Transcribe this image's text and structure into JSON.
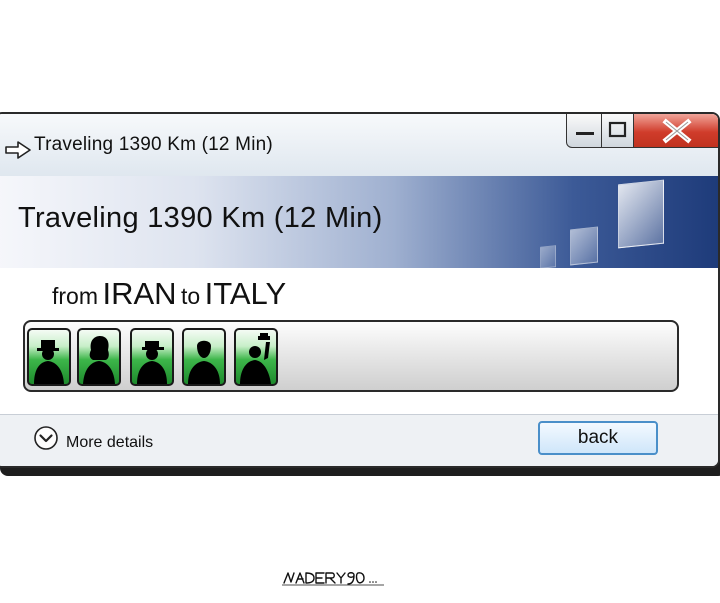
{
  "window": {
    "title": "Traveling 1390  Km (12 Min)",
    "caption_buttons": [
      "minimize-icon",
      "maximize-icon",
      "close-icon"
    ]
  },
  "header": {
    "title": "Traveling 1390  Km (12 Min)"
  },
  "route": {
    "from_word": "from",
    "origin": "IRAN",
    "to_word": "to",
    "destination": "ITALY"
  },
  "progress": {
    "fill_fraction": 0.4,
    "blocks": [
      {
        "figure": "man-with-hat-silhouette"
      },
      {
        "figure": "woman-silhouette"
      },
      {
        "figure": "person-with-cap-silhouette"
      },
      {
        "figure": "man-silhouette"
      },
      {
        "figure": "waving-person-silhouette"
      }
    ],
    "block_color": "#3db64a"
  },
  "footer": {
    "more_details_label": "More details",
    "back_label": "back"
  },
  "colors": {
    "header_dark": "#1e3b7a",
    "close_red": "#d03c2b",
    "button_border": "#4a8fc9"
  }
}
